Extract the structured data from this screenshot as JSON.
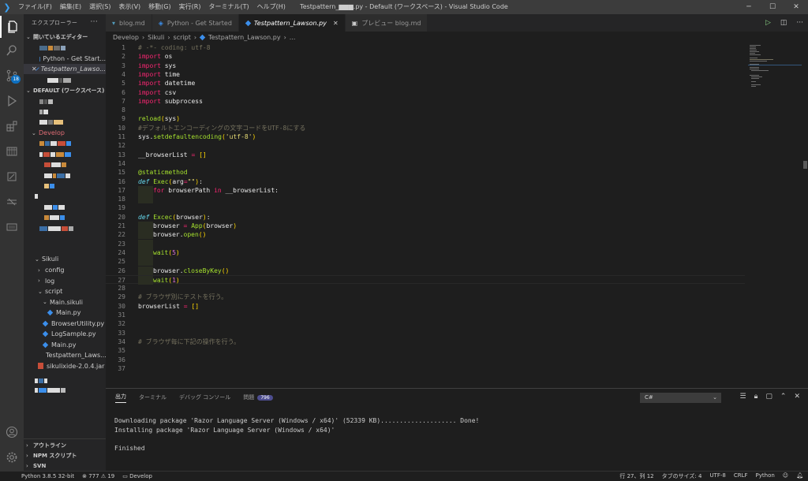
{
  "titlebar": {
    "menu": [
      "ファイル(F)",
      "編集(E)",
      "選択(S)",
      "表示(V)",
      "移動(G)",
      "実行(R)",
      "ターミナル(T)",
      "ヘルプ(H)"
    ],
    "title": "Testpattern_▆▆▆.py - Default (ワークスペース) - Visual Studio Code",
    "minimize": "─",
    "maximize": "☐",
    "close": "✕"
  },
  "activity": {
    "scm_badge": "18"
  },
  "sidebar": {
    "header": "エクスプローラー",
    "more": "···",
    "open_editors": {
      "title": "開いているエディター",
      "items": [
        "Python - Get Start...",
        "Testpattern_Lawso..."
      ]
    },
    "workspace": {
      "title": "DEFAULT (ワークスペース)",
      "develop_folder": "Develop",
      "sikuli_folder": "Sikuli",
      "tree": [
        {
          "label": "config",
          "indent": 2,
          "chevron": "›"
        },
        {
          "label": "log",
          "indent": 2,
          "chevron": "›"
        },
        {
          "label": "script",
          "indent": 2,
          "chevron": "⌄"
        },
        {
          "label": "Main.sikuli",
          "indent": 3,
          "chevron": "⌄"
        },
        {
          "label": "Main.py",
          "indent": 4,
          "icon": "py"
        },
        {
          "label": "BrowserUtility.py",
          "indent": 3,
          "icon": "py"
        },
        {
          "label": "LogSample.py",
          "indent": 3,
          "icon": "py"
        },
        {
          "label": "Main.py",
          "indent": 3,
          "icon": "py"
        },
        {
          "label": "Testpattern_Laws...",
          "indent": 3,
          "icon": "py"
        },
        {
          "label": "sikulixide-2.0.4.jar",
          "indent": 2,
          "icon": "jar"
        }
      ]
    },
    "bottom_sections": [
      "アウトライン",
      "NPM スクリプト",
      "SVN"
    ]
  },
  "tabs": [
    {
      "label": "blog.md",
      "icon": "md",
      "active": false
    },
    {
      "label": "Python - Get Started",
      "icon": "vs",
      "active": false
    },
    {
      "label": "Testpattern_Lawson.py",
      "icon": "py",
      "active": true,
      "close": "✕"
    },
    {
      "label": "プレビュー blog.md",
      "icon": "preview",
      "active": false
    }
  ],
  "breadcrumb": [
    "Develop",
    "Sikuli",
    "script",
    "Testpattern_Lawson.py",
    "..."
  ],
  "editor": {
    "lines": [
      {
        "n": "1",
        "tokens": [
          [
            "cm",
            "# -*- coding: utf-8"
          ]
        ]
      },
      {
        "n": "2",
        "tokens": [
          [
            "kw",
            "import"
          ],
          [
            "pl",
            " os"
          ]
        ]
      },
      {
        "n": "3",
        "tokens": [
          [
            "kw",
            "import"
          ],
          [
            "pl",
            " sys"
          ]
        ]
      },
      {
        "n": "4",
        "tokens": [
          [
            "kw",
            "import"
          ],
          [
            "pl",
            " time"
          ]
        ]
      },
      {
        "n": "5",
        "tokens": [
          [
            "kw",
            "import"
          ],
          [
            "pl",
            " datetime"
          ]
        ]
      },
      {
        "n": "6",
        "tokens": [
          [
            "kw",
            "import"
          ],
          [
            "pl",
            " csv"
          ]
        ]
      },
      {
        "n": "7",
        "tokens": [
          [
            "kw",
            "import"
          ],
          [
            "pl",
            " subprocess"
          ]
        ]
      },
      {
        "n": "8",
        "tokens": []
      },
      {
        "n": "9",
        "tokens": [
          [
            "fn",
            "reload"
          ],
          [
            "br",
            "("
          ],
          [
            "pl",
            "sys"
          ],
          [
            "br",
            ")"
          ]
        ]
      },
      {
        "n": "10",
        "tokens": [
          [
            "cm",
            "#デフォルトエンコーディングの文字コードをUTF-8にする"
          ]
        ]
      },
      {
        "n": "11",
        "tokens": [
          [
            "pl",
            "sys."
          ],
          [
            "fn",
            "setdefaultencoding"
          ],
          [
            "br",
            "("
          ],
          [
            "str",
            "'utf-8'"
          ],
          [
            "br",
            ")"
          ]
        ]
      },
      {
        "n": "12",
        "tokens": []
      },
      {
        "n": "13",
        "tokens": [
          [
            "pl",
            "__browserList "
          ],
          [
            "kw",
            "="
          ],
          [
            "pl",
            " "
          ],
          [
            "br",
            "[]"
          ]
        ]
      },
      {
        "n": "14",
        "tokens": []
      },
      {
        "n": "15",
        "tokens": [
          [
            "dec",
            "@staticmethod"
          ]
        ]
      },
      {
        "n": "16",
        "tokens": [
          [
            "kw2",
            "def"
          ],
          [
            "pl",
            " "
          ],
          [
            "fn",
            "Exec"
          ],
          [
            "br",
            "("
          ],
          [
            "pl",
            "arg"
          ],
          [
            "kw",
            "="
          ],
          [
            "str",
            "\"\""
          ],
          [
            "br",
            ")"
          ],
          [
            "pl",
            ":"
          ]
        ]
      },
      {
        "n": "17",
        "indent": 1,
        "tokens": [
          [
            "kw",
            "for"
          ],
          [
            "pl",
            " browserPath "
          ],
          [
            "kw",
            "in"
          ],
          [
            "pl",
            " __browserList:"
          ]
        ]
      },
      {
        "n": "18",
        "indent": 1,
        "tokens": []
      },
      {
        "n": "19",
        "tokens": []
      },
      {
        "n": "20",
        "tokens": [
          [
            "kw2",
            "def"
          ],
          [
            "pl",
            " "
          ],
          [
            "fn",
            "Excec"
          ],
          [
            "br",
            "("
          ],
          [
            "pl",
            "browser"
          ],
          [
            "br",
            ")"
          ],
          [
            "pl",
            ":"
          ]
        ]
      },
      {
        "n": "21",
        "indent": 1,
        "tokens": [
          [
            "pl",
            "browser "
          ],
          [
            "kw",
            "="
          ],
          [
            "pl",
            " "
          ],
          [
            "fn",
            "App"
          ],
          [
            "br",
            "("
          ],
          [
            "pl",
            "browser"
          ],
          [
            "br",
            ")"
          ]
        ]
      },
      {
        "n": "22",
        "indent": 1,
        "tokens": [
          [
            "pl",
            "browser."
          ],
          [
            "fn",
            "open"
          ],
          [
            "br",
            "()"
          ]
        ]
      },
      {
        "n": "23",
        "indent": 1,
        "tokens": []
      },
      {
        "n": "24",
        "indent": 1,
        "tokens": [
          [
            "fn",
            "wait"
          ],
          [
            "br",
            "("
          ],
          [
            "br2",
            "5"
          ],
          [
            "br",
            ")"
          ]
        ]
      },
      {
        "n": "25",
        "indent": 1,
        "tokens": []
      },
      {
        "n": "26",
        "indent": 1,
        "tokens": [
          [
            "pl",
            "browser."
          ],
          [
            "fn",
            "closeByKey"
          ],
          [
            "br",
            "()"
          ]
        ]
      },
      {
        "n": "27",
        "indent": 1,
        "current": true,
        "tokens": [
          [
            "fn",
            "wait"
          ],
          [
            "br",
            "("
          ],
          [
            "br2",
            "1"
          ],
          [
            "br",
            ")"
          ]
        ]
      },
      {
        "n": "28",
        "tokens": []
      },
      {
        "n": "29",
        "tokens": [
          [
            "cm",
            "# ブラウザ別にテストを行う。"
          ]
        ]
      },
      {
        "n": "30",
        "tokens": [
          [
            "pl",
            "browserList "
          ],
          [
            "kw",
            "="
          ],
          [
            "pl",
            " "
          ],
          [
            "br",
            "[]"
          ]
        ]
      },
      {
        "n": "31",
        "tokens": []
      },
      {
        "n": "32",
        "tokens": []
      },
      {
        "n": "33",
        "tokens": []
      },
      {
        "n": "34",
        "tokens": [
          [
            "cm",
            "# ブラウザ毎に下記の操作を行う。"
          ]
        ]
      },
      {
        "n": "35",
        "tokens": []
      },
      {
        "n": "36",
        "tokens": []
      },
      {
        "n": "37",
        "tokens": []
      }
    ]
  },
  "panel": {
    "tabs": [
      "出力",
      "ターミナル",
      "デバッグ コンソール",
      "問題"
    ],
    "problems_count": "796",
    "channel": "C#",
    "output": "Downloading package 'Razor Language Server (Windows / x64)' (52339 KB).................... Done!\nInstalling package 'Razor Language Server (Windows / x64)'\n\nFinished"
  },
  "statusbar": {
    "python": "Python 3.8.5 32-bit",
    "errors": "777",
    "warnings": "19",
    "folder": "Develop",
    "position": "行 27、列 12",
    "tabsize": "タブのサイズ: 4",
    "encoding": "UTF-8",
    "eol": "CRLF",
    "language": "Python"
  },
  "colors": {
    "keyword": "#f92672",
    "function": "#a6e22e",
    "string": "#e6db74",
    "comment": "#75715e",
    "accent": "#0e70c0"
  }
}
